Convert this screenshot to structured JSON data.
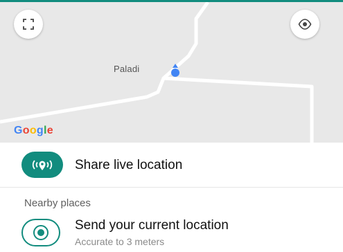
{
  "map": {
    "place_label": "Paladi",
    "provider_logo": "Google",
    "fullscreen_button_icon": "fullscreen-icon",
    "locate_button_icon": "my-location-icon",
    "pin_icon": "location-pin-icon"
  },
  "share_live": {
    "label": "Share live location",
    "icon": "live-location-icon"
  },
  "nearby": {
    "section_title": "Nearby places",
    "send_current": {
      "label": "Send your current location",
      "accuracy": "Accurate to 3 meters",
      "icon": "current-location-icon"
    }
  },
  "colors": {
    "accent": "#128c7e",
    "pin": "#4285f4",
    "map_bg": "#e8e8e8"
  }
}
